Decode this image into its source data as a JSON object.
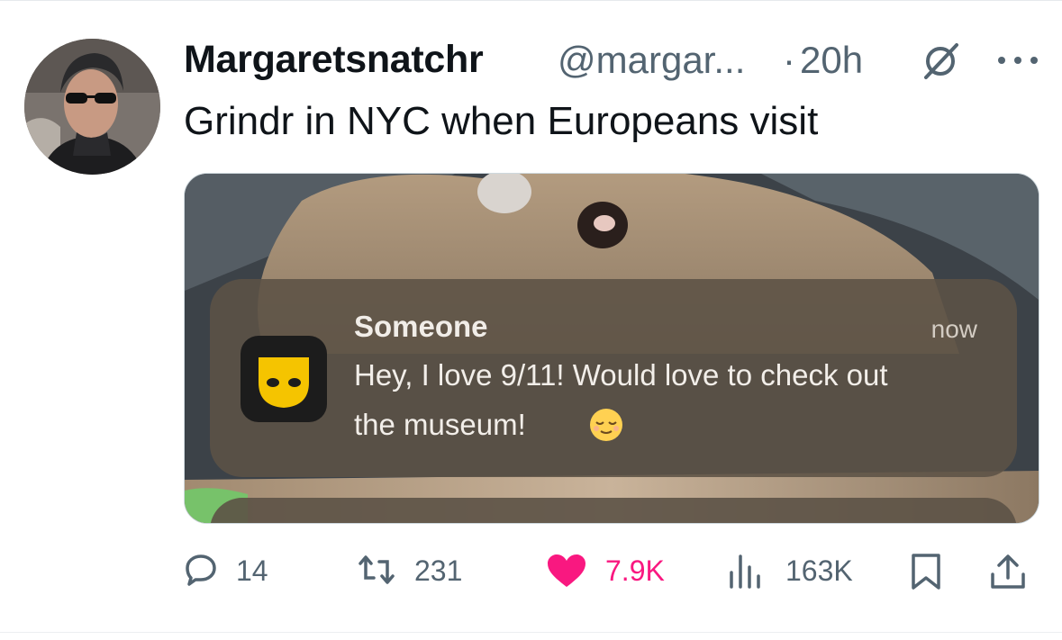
{
  "tweet": {
    "display_name": "Margaretsnatchr",
    "handle": "@margar...",
    "separator": "·",
    "time": "20h",
    "text": "Grindr in NYC when Europeans visit"
  },
  "notification": {
    "app_icon": "grindr-mask-icon",
    "title": "Someone",
    "time": "now",
    "line1": "Hey, I love 9/11! Would love to check out",
    "line2": "the museum!",
    "emoji": "relieved-face"
  },
  "actions": {
    "replies": "14",
    "reposts": "231",
    "likes": "7.9K",
    "views": "163K"
  },
  "colors": {
    "text_primary": "#0f1419",
    "text_secondary": "#536471",
    "like_pink": "#f91880",
    "grindr_yellow": "#f5c400"
  }
}
